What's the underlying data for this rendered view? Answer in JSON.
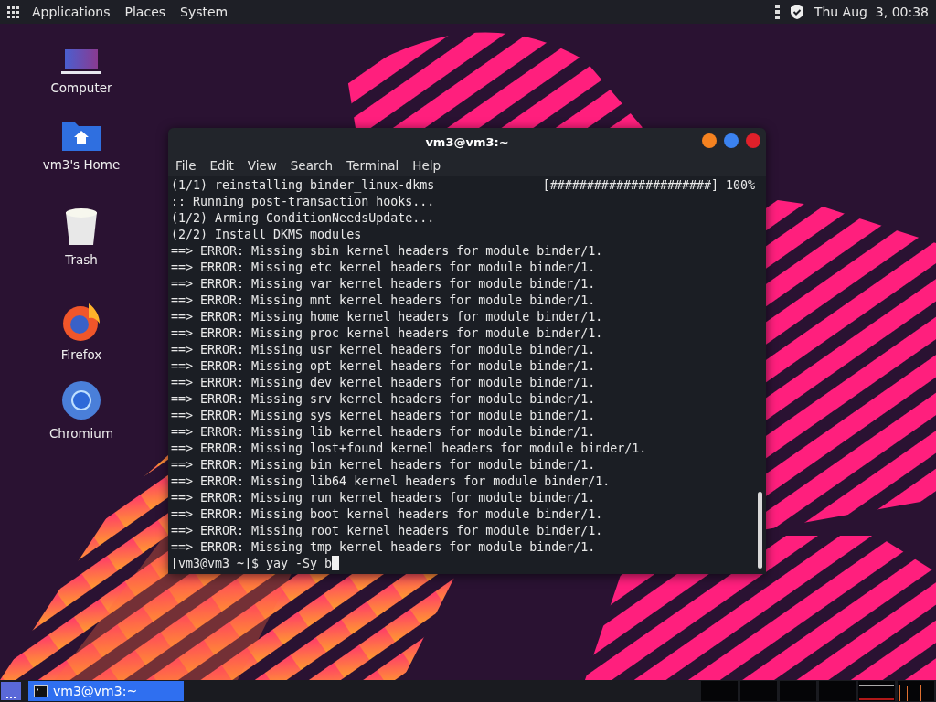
{
  "top_panel": {
    "menus": [
      "Applications",
      "Places",
      "System"
    ],
    "clock": "Thu Aug  3, 00:38"
  },
  "desktop_icons": [
    {
      "kind": "computer",
      "label": "Computer"
    },
    {
      "kind": "home",
      "label": "vm3's Home"
    },
    {
      "kind": "trash",
      "label": "Trash"
    },
    {
      "kind": "firefox",
      "label": "Firefox"
    },
    {
      "kind": "chromium",
      "label": "Chromium"
    }
  ],
  "terminal": {
    "title": "vm3@vm3:~",
    "menu": [
      "File",
      "Edit",
      "View",
      "Search",
      "Terminal",
      "Help"
    ],
    "progress_line": {
      "label": "(1/1) reinstalling binder_linux-dkms",
      "bar": "[######################]",
      "percent": "100%"
    },
    "lines": [
      ":: Running post-transaction hooks...",
      "(1/2) Arming ConditionNeedsUpdate...",
      "(2/2) Install DKMS modules",
      "==> ERROR: Missing sbin kernel headers for module binder/1.",
      "==> ERROR: Missing etc kernel headers for module binder/1.",
      "==> ERROR: Missing var kernel headers for module binder/1.",
      "==> ERROR: Missing mnt kernel headers for module binder/1.",
      "==> ERROR: Missing home kernel headers for module binder/1.",
      "==> ERROR: Missing proc kernel headers for module binder/1.",
      "==> ERROR: Missing usr kernel headers for module binder/1.",
      "==> ERROR: Missing opt kernel headers for module binder/1.",
      "==> ERROR: Missing dev kernel headers for module binder/1.",
      "==> ERROR: Missing srv kernel headers for module binder/1.",
      "==> ERROR: Missing sys kernel headers for module binder/1.",
      "==> ERROR: Missing lib kernel headers for module binder/1.",
      "==> ERROR: Missing lost+found kernel headers for module binder/1.",
      "==> ERROR: Missing bin kernel headers for module binder/1.",
      "==> ERROR: Missing lib64 kernel headers for module binder/1.",
      "==> ERROR: Missing run kernel headers for module binder/1.",
      "==> ERROR: Missing boot kernel headers for module binder/1.",
      "==> ERROR: Missing root kernel headers for module binder/1.",
      "==> ERROR: Missing tmp kernel headers for module binder/1."
    ],
    "prompt": "[vm3@vm3 ~]$ ",
    "command": "yay -Sy b"
  },
  "taskbar": {
    "tasks": [
      {
        "label": "vm3@vm3:~",
        "selected": true
      }
    ]
  }
}
